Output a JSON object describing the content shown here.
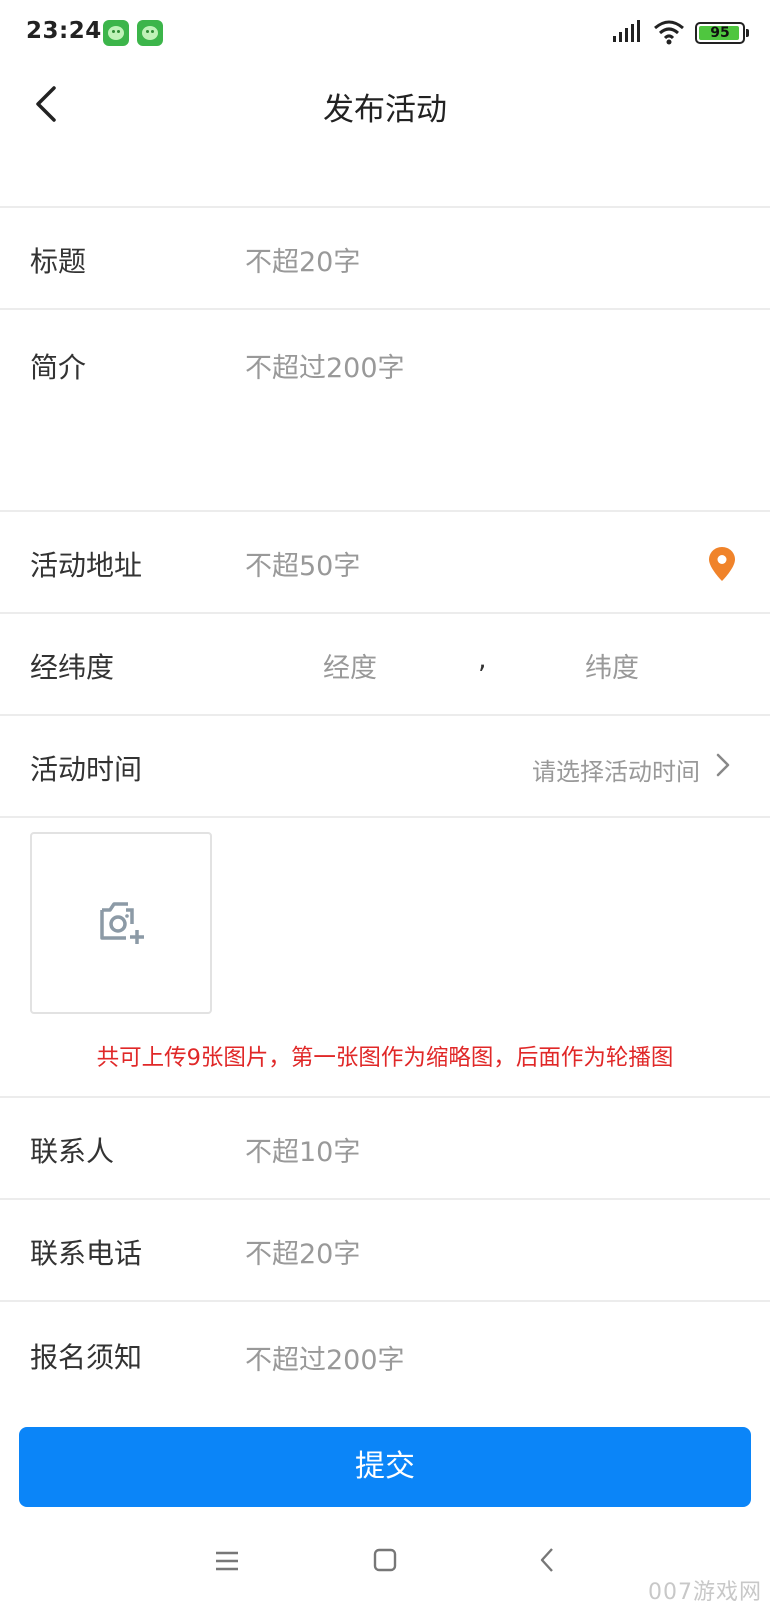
{
  "status_bar": {
    "time": "23:24",
    "battery": "95",
    "battery_level_percent": 95,
    "battery_color": "#4fc63f"
  },
  "header": {
    "title": "发布活动"
  },
  "form": {
    "title": {
      "label": "标题",
      "placeholder": "不超20字"
    },
    "intro": {
      "label": "简介",
      "placeholder": "不超过200字"
    },
    "address": {
      "label": "活动地址",
      "placeholder": "不超50字",
      "icon": "location-pin-icon",
      "icon_color": "#f0832a"
    },
    "coords": {
      "label": "经纬度",
      "longitude_placeholder": "经度",
      "separator": ",",
      "latitude_placeholder": "纬度"
    },
    "time": {
      "label": "活动时间",
      "hint": "请选择活动时间"
    },
    "upload": {
      "icon": "camera-add-icon",
      "note": "共可上传9张图片，第一张图作为缩略图，后面作为轮播图",
      "note_color": "#e02828"
    },
    "contact": {
      "label": "联系人",
      "placeholder": "不超10字"
    },
    "phone": {
      "label": "联系电话",
      "placeholder": "不超20字"
    },
    "notice": {
      "label": "报名须知",
      "placeholder": "不超过200字"
    }
  },
  "submit_label": "提交",
  "accent_color": "#0b85f8",
  "watermark": "007游戏网"
}
